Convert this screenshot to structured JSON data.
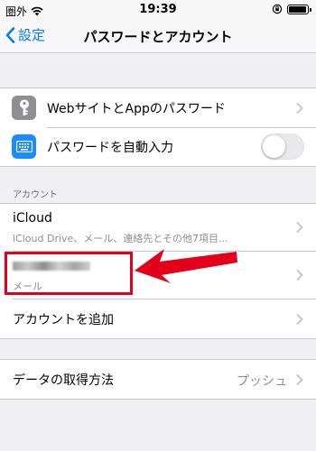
{
  "status_bar": {
    "carrier": "圏外",
    "time": "19:39",
    "battery_level": 0.85
  },
  "nav": {
    "back_label": "設定",
    "title": "パスワードとアカウント"
  },
  "passwords": {
    "website_passwords_label": "WebサイトとAppのパスワード",
    "autofill_label": "パスワードを自動入力",
    "autofill_on": false
  },
  "accounts": {
    "section_header": "アカウント",
    "icloud_title": "iCloud",
    "icloud_subtitle": "iCloud Drive、メール、連絡先とその他7項目...",
    "mail_account_subtitle": "メール",
    "add_account_label": "アカウントを追加"
  },
  "fetch": {
    "label": "データの取得方法",
    "value": "プッシュ"
  },
  "colors": {
    "accent": "#007aff",
    "highlight": "#e2001a",
    "key_icon_bg": "#8e8e93",
    "keyboard_icon_bg": "#1a8cff"
  },
  "icons": [
    "key-icon",
    "keyboard-icon",
    "chevron-right-icon",
    "wifi-icon",
    "orientation-lock-icon",
    "red-arrow"
  ]
}
